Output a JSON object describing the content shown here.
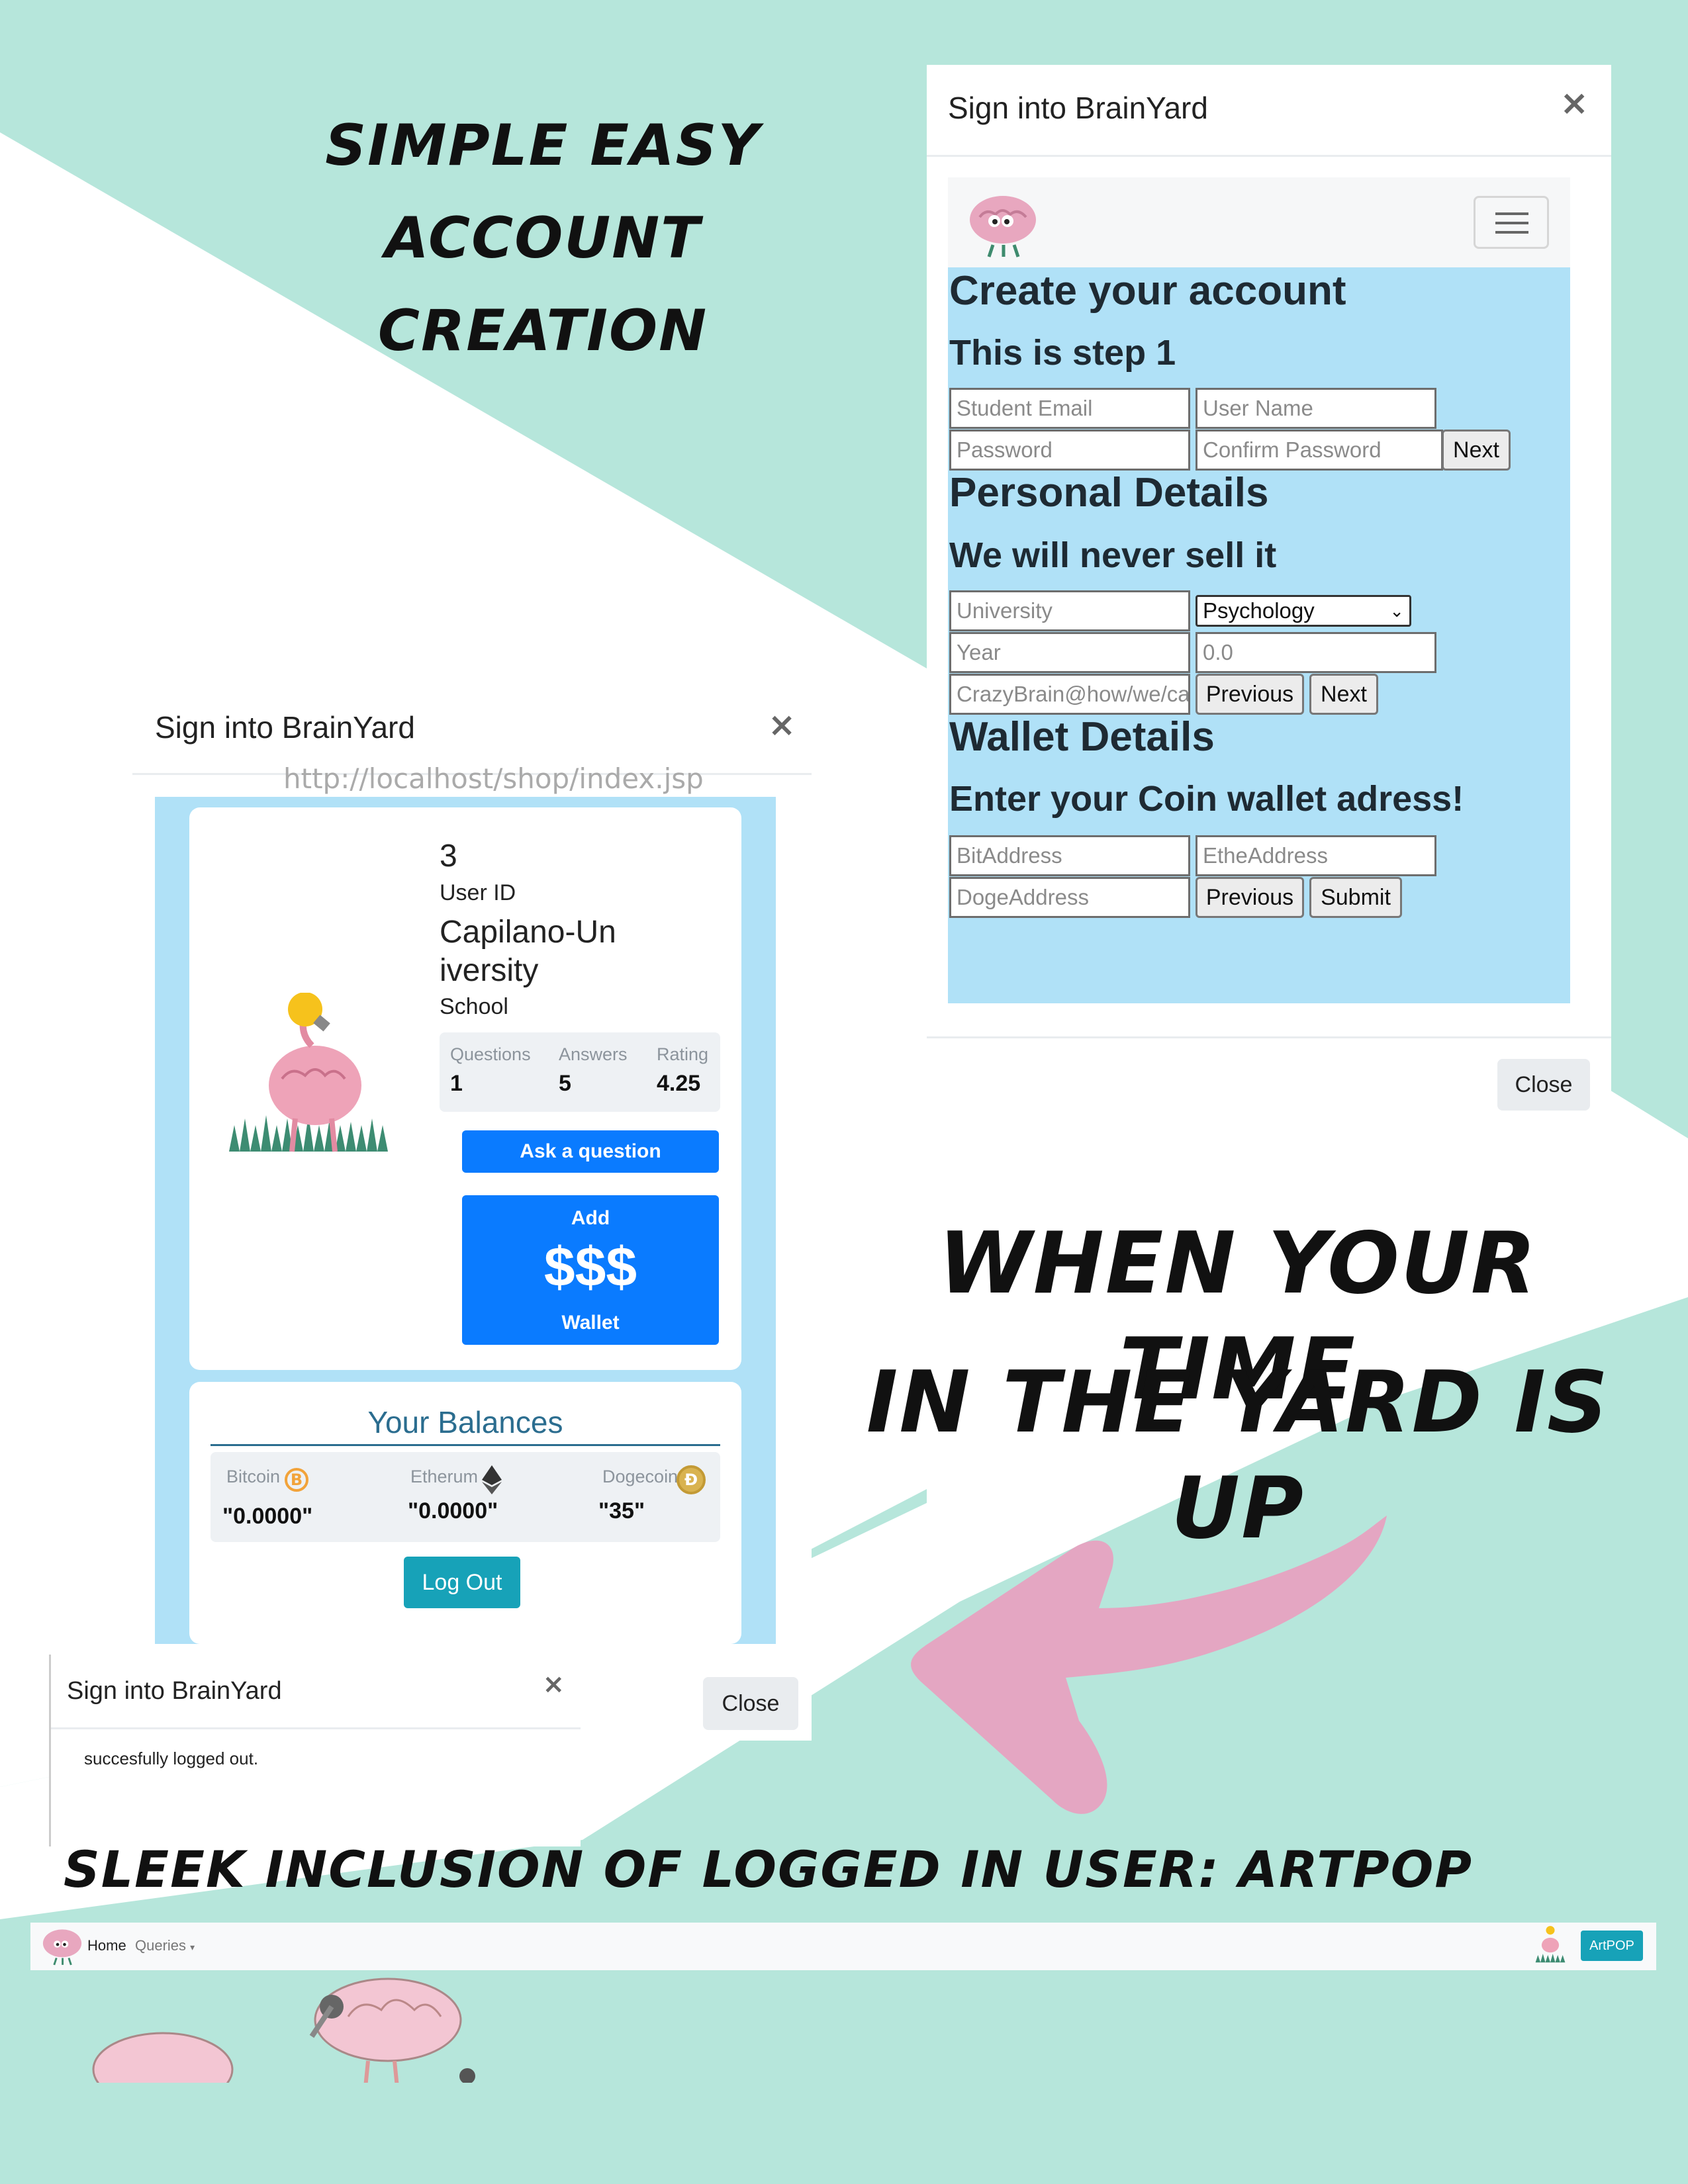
{
  "poster": {
    "headline_1": "Simple Easy Account Creation",
    "headline_2_line1": "When your time",
    "headline_2_line2": "in the yard is up",
    "headline_3": "Sleek inclusion of logged in user: ArtPOP"
  },
  "colors": {
    "background_mint": "#b6e6db",
    "form_blue": "#b0e1f7",
    "primary_blue": "#0a7bff",
    "teal": "#17a2b8",
    "heading_teal": "#2b6d8f",
    "arrow_pink": "#e4a6c2"
  },
  "signup_modal": {
    "title": "Sign into BrainYard",
    "close_icon": "×",
    "menu_icon": "hamburger-menu-icon",
    "heading_create": "Create your account",
    "step_text": "This is step 1",
    "email_placeholder": "Student Email",
    "username_placeholder": "User Name",
    "password_placeholder": "Password",
    "confirm_placeholder": "Confirm Password",
    "next_label": "Next",
    "heading_personal": "Personal Details",
    "personal_sub": "We will never sell it",
    "university_placeholder": "University",
    "major_selected": "Psychology",
    "year_placeholder": "Year",
    "gpa_placeholder": "0.0",
    "bio_placeholder": "CrazyBrain@how/we/ca",
    "previous_label": "Previous",
    "next2_label": "Next",
    "heading_wallet": "Wallet Details",
    "wallet_sub": "Enter your Coin wallet adress!",
    "bit_placeholder": "BitAddress",
    "ethe_placeholder": "EtheAddress",
    "doge_placeholder": "DogeAddress",
    "previous2_label": "Previous",
    "submit_label": "Submit",
    "close_button": "Close"
  },
  "profile_modal": {
    "title": "Sign into BrainYard",
    "close_icon": "×",
    "url_watermark": "http://localhost/shop/index.jsp",
    "user_id_value": "3",
    "user_id_label": "User ID",
    "school_value": "Capilano-University",
    "school_label": "School",
    "stats": [
      {
        "label": "Questions",
        "value": "1"
      },
      {
        "label": "Answers",
        "value": "5"
      },
      {
        "label": "Rating",
        "value": "4.25"
      }
    ],
    "ask_button": "Ask a question",
    "wallet_button_top": "Add",
    "wallet_button_main": "$$$",
    "wallet_button_bottom": "Wallet",
    "balances_title": "Your Balances",
    "balances": [
      {
        "label": "Bitcoin",
        "value": "\"0.0000\"",
        "icon": "bitcoin-icon"
      },
      {
        "label": "Etherum",
        "value": "\"0.0000\"",
        "icon": "ethereum-icon"
      },
      {
        "label": "Dogecoin",
        "value": "\"35\"",
        "icon": "dogecoin-icon"
      }
    ],
    "logout_button": "Log Out",
    "close_button": "Close"
  },
  "logout_modal": {
    "title": "Sign into BrainYard",
    "close_icon": "×",
    "message": "succesfully logged out."
  },
  "navbar": {
    "home": "Home",
    "queries": "Queries",
    "user_badge": "ArtPOP"
  }
}
